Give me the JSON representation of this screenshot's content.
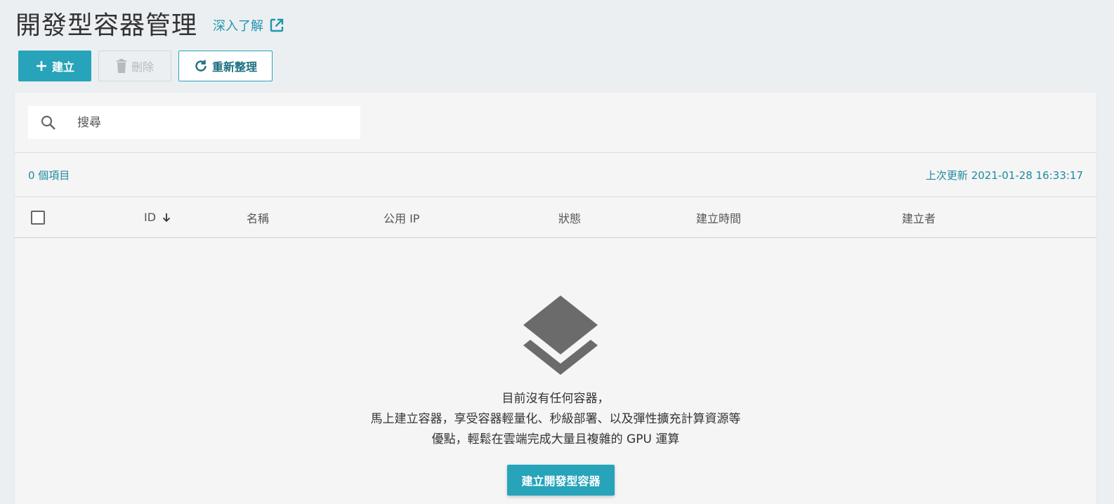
{
  "header": {
    "title": "開發型容器管理",
    "learn_more": "深入了解"
  },
  "toolbar": {
    "create_label": "建立",
    "delete_label": "刪除",
    "refresh_label": "重新整理"
  },
  "search": {
    "placeholder": "搜尋",
    "value": ""
  },
  "info": {
    "count": "0 個項目",
    "last_updated": "上次更新 2021-01-28 16:33:17"
  },
  "table": {
    "columns": [
      "ID",
      "名稱",
      "公用 IP",
      "狀態",
      "建立時間",
      "建立者"
    ],
    "sort_column": "ID",
    "sort_direction": "desc",
    "rows": []
  },
  "empty_state": {
    "line1": "目前沒有任何容器，",
    "line2": "馬上建立容器，享受容器輕量化、秒級部署、以及彈性擴充計算資源等",
    "line3": "優點，輕鬆在雲端完成大量且複雜的 GPU 運算",
    "cta_label": "建立開發型容器",
    "icon": "layers-icon"
  },
  "colors": {
    "accent": "#27a3ba",
    "link": "#2196ad",
    "background": "#eceff2",
    "panel": "#f5f5f5",
    "icon_gray": "#6b6b6b"
  }
}
